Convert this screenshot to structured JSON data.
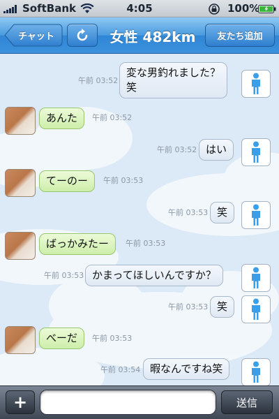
{
  "status_bar": {
    "carrier": "SoftBank",
    "time": "4:05",
    "battery": "100%",
    "icons": [
      "signal-icon",
      "wifi-icon",
      "rotation-lock-icon",
      "battery-icon"
    ]
  },
  "nav": {
    "back_label": "チャット",
    "title": "女性 482km",
    "add_friend_label": "友たち追加",
    "refresh_icon": "refresh-icon"
  },
  "messages": [
    {
      "side": "out",
      "text": "変な男釣れました？\n笑",
      "time": "午前 03:52"
    },
    {
      "side": "in",
      "text": "あんた",
      "time": "午前 03:52"
    },
    {
      "side": "out",
      "text": "はい",
      "time": "午前 03:52"
    },
    {
      "side": "in",
      "text": "てーのー",
      "time": "午前 03:53"
    },
    {
      "side": "out",
      "text": "笑",
      "time": "午前 03:53"
    },
    {
      "side": "in",
      "text": "ばっかみたー",
      "time": "午前 03:53"
    },
    {
      "side": "out",
      "text": "かまってほしいんですか？",
      "time": "午前 03:53"
    },
    {
      "side": "out",
      "text": "笑",
      "time": "午前 03:53"
    },
    {
      "side": "in",
      "text": "べーだ",
      "time": "午前 03:53"
    },
    {
      "side": "out",
      "text": "暇なんですね笑",
      "time": "午前 03:54"
    }
  ],
  "composer": {
    "plus_label": "+",
    "input_value": "",
    "input_placeholder": "",
    "send_label": "送信"
  },
  "colors": {
    "nav_blue": "#3d91dc",
    "incoming_bubble": "#d6f2b8",
    "outgoing_bubble": "#e8eef6",
    "self_avatar_icon": "#3a9ee8"
  }
}
